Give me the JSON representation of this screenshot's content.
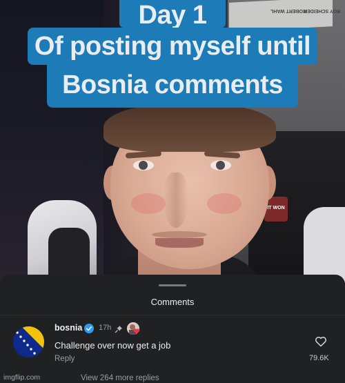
{
  "caption": {
    "line1": "Day 1",
    "line2": "Of posting myself until",
    "line3": "Bosnia comments"
  },
  "background": {
    "poster_text_a": "ROBERT WAHL",
    "poster_text_b": "ROY SCHEIDER",
    "chair_badge": "IT WON"
  },
  "comments_sheet": {
    "title": "Comments",
    "comment": {
      "username": "bosnia",
      "time": "17h",
      "text": "Challenge over now get a job",
      "reply_label": "Reply",
      "like_count": "79.6K"
    },
    "view_more": "View 264 more replies"
  },
  "watermark": "imgflip.com",
  "icons": [
    "verified-badge-icon",
    "pin-icon",
    "heart-icon",
    "bosnia-flag-avatar"
  ],
  "colors": {
    "caption_bg": "#1d7cb8",
    "sheet_bg": "#202122",
    "verified_blue": "#2f9bf0"
  }
}
